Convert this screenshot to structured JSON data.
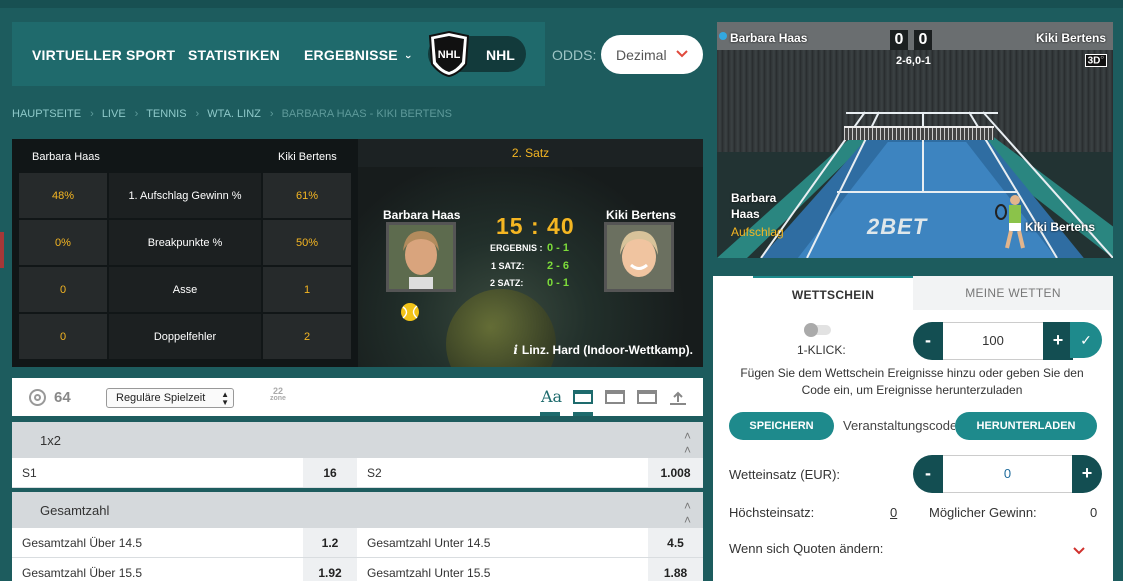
{
  "nav": {
    "items": [
      "VIRTUELLER SPORT",
      "STATISTIKEN",
      "ERGEBNISSE"
    ],
    "dropdown_marker": "›",
    "nhl_label": "NHL",
    "odds_label": "ODDS:",
    "odds_value": "Dezimal"
  },
  "breadcrumb": [
    "HAUPTSEITE",
    "LIVE",
    "TENNIS",
    "WTA. LINZ",
    "BARBARA HAAS - KIKI BERTENS"
  ],
  "scoreboard": {
    "player1": "Barbara Haas",
    "player2": "Kiki Bertens",
    "set_label": "2. Satz",
    "stats": [
      {
        "p1": "48%",
        "label": "1. Aufschlag Gewinn %",
        "p2": "61%"
      },
      {
        "p1": "0%",
        "label": "Breakpunkte %",
        "p2": "50%"
      },
      {
        "p1": "0",
        "label": "Asse",
        "p2": "1"
      },
      {
        "p1": "0",
        "label": "Doppelfehler",
        "p2": "2"
      }
    ],
    "game_score": "15 : 40",
    "lines": [
      {
        "label": "ERGEBNIS :",
        "value": "0 - 1"
      },
      {
        "label": "1 SATZ:",
        "value": "2 - 6"
      },
      {
        "label": "2 SATZ:",
        "value": "0 - 1"
      }
    ],
    "venue": "Linz. Hard (Indoor-Wettkamp)."
  },
  "toolbar": {
    "count": "64",
    "period": "Reguläre Spielzeit",
    "zone_num": "22",
    "zone_text": "zone",
    "font_toggle": "Aa"
  },
  "markets": [
    {
      "title": "1x2",
      "rows": [
        {
          "l_name": "S1",
          "l_odd": "16",
          "r_name": "S2",
          "r_odd": "1.008"
        }
      ]
    },
    {
      "title": "Gesamtzahl",
      "rows": [
        {
          "l_name": "Gesamtzahl Über 14.5",
          "l_odd": "1.2",
          "r_name": "Gesamtzahl Unter 14.5",
          "r_odd": "4.5"
        },
        {
          "l_name": "Gesamtzahl Über 15.5",
          "l_odd": "1.92",
          "r_name": "Gesamtzahl Unter 15.5",
          "r_odd": "1.88"
        }
      ]
    }
  ],
  "video": {
    "player1": "Barbara Haas",
    "player1_line1": "Barbara",
    "player1_line2": "Haas",
    "player2": "Kiki Bertens",
    "score1": "0",
    "score2": "0",
    "sets": "2-6,0-1",
    "mode": "3D",
    "serving": "Aufschlag",
    "logo": "2BET"
  },
  "betslip": {
    "tab_active": "WETTSCHEIN",
    "tab_inactive": "MEINE WETTEN",
    "oneclick_label": "1-KLICK:",
    "oneclick_amount": "100",
    "hint": "Fügen Sie dem Wettschein Ereignisse hinzu oder geben Sie den Code ein, um Ereignisse herunterzuladen",
    "save_label": "SPEICHERN",
    "code_placeholder": "Veranstaltungscode",
    "download_label": "HERUNTERLADEN",
    "stake_label": "Wetteinsatz (EUR):",
    "stake_value": "0",
    "max_label": "Höchsteinsatz:",
    "max_value": "0",
    "win_label": "Möglicher Gewinn:",
    "win_value": "0",
    "odds_change_label": "Wenn sich Quoten ändern:"
  }
}
